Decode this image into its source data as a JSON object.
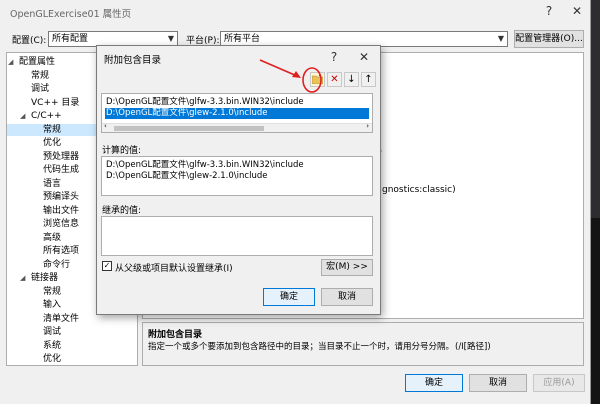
{
  "window": {
    "title": "OpenGLExercise01 属性页",
    "help": "?",
    "close": "✕"
  },
  "top_bar": {
    "config_label": "配置(C):",
    "config_value": "所有配置",
    "platform_label": "平台(P):",
    "platform_value": "所有平台",
    "config_manager": "配置管理器(O)..."
  },
  "tree": [
    {
      "label": "配置属性",
      "level": 0,
      "expanded": true
    },
    {
      "label": "常规",
      "level": 1
    },
    {
      "label": "调试",
      "level": 1
    },
    {
      "label": "VC++ 目录",
      "level": 1
    },
    {
      "label": "C/C++",
      "level": 1,
      "expanded": true
    },
    {
      "label": "常规",
      "level": 2,
      "selected": true
    },
    {
      "label": "优化",
      "level": 2
    },
    {
      "label": "预处理器",
      "level": 2
    },
    {
      "label": "代码生成",
      "level": 2
    },
    {
      "label": "语言",
      "level": 2
    },
    {
      "label": "预编译头",
      "level": 2
    },
    {
      "label": "输出文件",
      "level": 2
    },
    {
      "label": "浏览信息",
      "level": 2
    },
    {
      "label": "高级",
      "level": 2
    },
    {
      "label": "所有选项",
      "level": 2
    },
    {
      "label": "命令行",
      "level": 2
    },
    {
      "label": "链接器",
      "level": 1,
      "expanded": true
    },
    {
      "label": "常规",
      "level": 2
    },
    {
      "label": "输入",
      "level": 2
    },
    {
      "label": "清单文件",
      "level": 2
    },
    {
      "label": "调试",
      "level": 2
    },
    {
      "label": "系统",
      "level": 2
    },
    {
      "label": "优化",
      "level": 2
    }
  ],
  "right_pane": {
    "partial_1": "))",
    "partial_2": ")",
    "partial_3": "gnostics:classic)"
  },
  "description": {
    "title": "附加包含目录",
    "text": "指定一个或多个要添加到包含路径中的目录；当目录不止一个时，请用分号分隔。",
    "switch": "(/I[路径])"
  },
  "bottom_buttons": {
    "ok": "确定",
    "cancel": "取消",
    "apply": "应用(A)"
  },
  "dialog": {
    "title": "附加包含目录",
    "help": "?",
    "close": "✕",
    "entries": [
      "D:\\OpenGL配置文件\\glfw-3.3.bin.WIN32\\include",
      "D:\\OpenGL配置文件\\glew-2.1.0\\include"
    ],
    "selected_index": 1,
    "computed_label": "计算的值:",
    "computed_values": [
      "D:\\OpenGL配置文件\\glfw-3.3.bin.WIN32\\include",
      "D:\\OpenGL配置文件\\glew-2.1.0\\include"
    ],
    "inherited_label": "继承的值:",
    "inherit_checkbox_label": "从父级或项目默认设置继承(I)",
    "inherit_checked": true,
    "macro_button": "宏(M) >>",
    "ok": "确定",
    "cancel": "取消"
  },
  "toolbar_icons": [
    "new-folder-icon",
    "delete-icon",
    "move-down-icon",
    "move-up-icon"
  ],
  "annotation_color": "#e02020"
}
